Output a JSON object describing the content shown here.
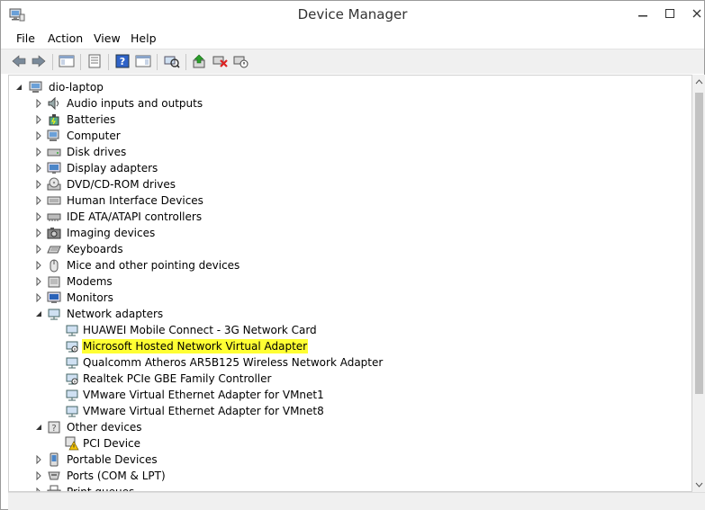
{
  "window": {
    "title": "Device Manager"
  },
  "menu": {
    "items": [
      "File",
      "Action",
      "View",
      "Help"
    ]
  },
  "toolbar": {
    "buttons": [
      "back-icon",
      "forward-icon",
      "show-hide-console-tree-icon",
      "properties-icon",
      "help-icon",
      "show-action-pane-icon",
      "scan-hardware-icon",
      "update-driver-icon",
      "uninstall-icon",
      "disable-device-icon"
    ]
  },
  "tree": {
    "root": "dio-laptop",
    "categories": [
      {
        "label": "Audio inputs and outputs",
        "expanded": false,
        "icon": "audio-icon"
      },
      {
        "label": "Batteries",
        "expanded": false,
        "icon": "battery-icon"
      },
      {
        "label": "Computer",
        "expanded": false,
        "icon": "computer-icon"
      },
      {
        "label": "Disk drives",
        "expanded": false,
        "icon": "disk-icon"
      },
      {
        "label": "Display adapters",
        "expanded": false,
        "icon": "display-icon"
      },
      {
        "label": "DVD/CD-ROM drives",
        "expanded": false,
        "icon": "dvd-icon"
      },
      {
        "label": "Human Interface Devices",
        "expanded": false,
        "icon": "hid-icon"
      },
      {
        "label": "IDE ATA/ATAPI controllers",
        "expanded": false,
        "icon": "ide-icon"
      },
      {
        "label": "Imaging devices",
        "expanded": false,
        "icon": "camera-icon"
      },
      {
        "label": "Keyboards",
        "expanded": false,
        "icon": "keyboard-icon"
      },
      {
        "label": "Mice and other pointing devices",
        "expanded": false,
        "icon": "mouse-icon"
      },
      {
        "label": "Modems",
        "expanded": false,
        "icon": "modem-icon"
      },
      {
        "label": "Monitors",
        "expanded": false,
        "icon": "monitor-icon"
      },
      {
        "label": "Network adapters",
        "expanded": true,
        "icon": "network-icon"
      },
      {
        "label": "Other devices",
        "expanded": true,
        "icon": "unknown-device-icon"
      },
      {
        "label": "Portable Devices",
        "expanded": false,
        "icon": "portable-icon"
      },
      {
        "label": "Ports (COM & LPT)",
        "expanded": false,
        "icon": "port-icon"
      },
      {
        "label": "Print queues",
        "expanded": false,
        "icon": "printer-icon"
      }
    ],
    "network_adapters": [
      "HUAWEI Mobile Connect - 3G Network Card",
      "Microsoft Hosted Network Virtual Adapter",
      "Qualcomm Atheros AR5B125 Wireless Network Adapter",
      "Realtek PCIe GBE Family Controller",
      "VMware Virtual Ethernet Adapter for VMnet1",
      "VMware Virtual Ethernet Adapter for VMnet8"
    ],
    "other_devices": [
      "PCI Device"
    ],
    "highlighted_item": "Microsoft Hosted Network Virtual Adapter",
    "highlight_color": "#ffff33"
  }
}
